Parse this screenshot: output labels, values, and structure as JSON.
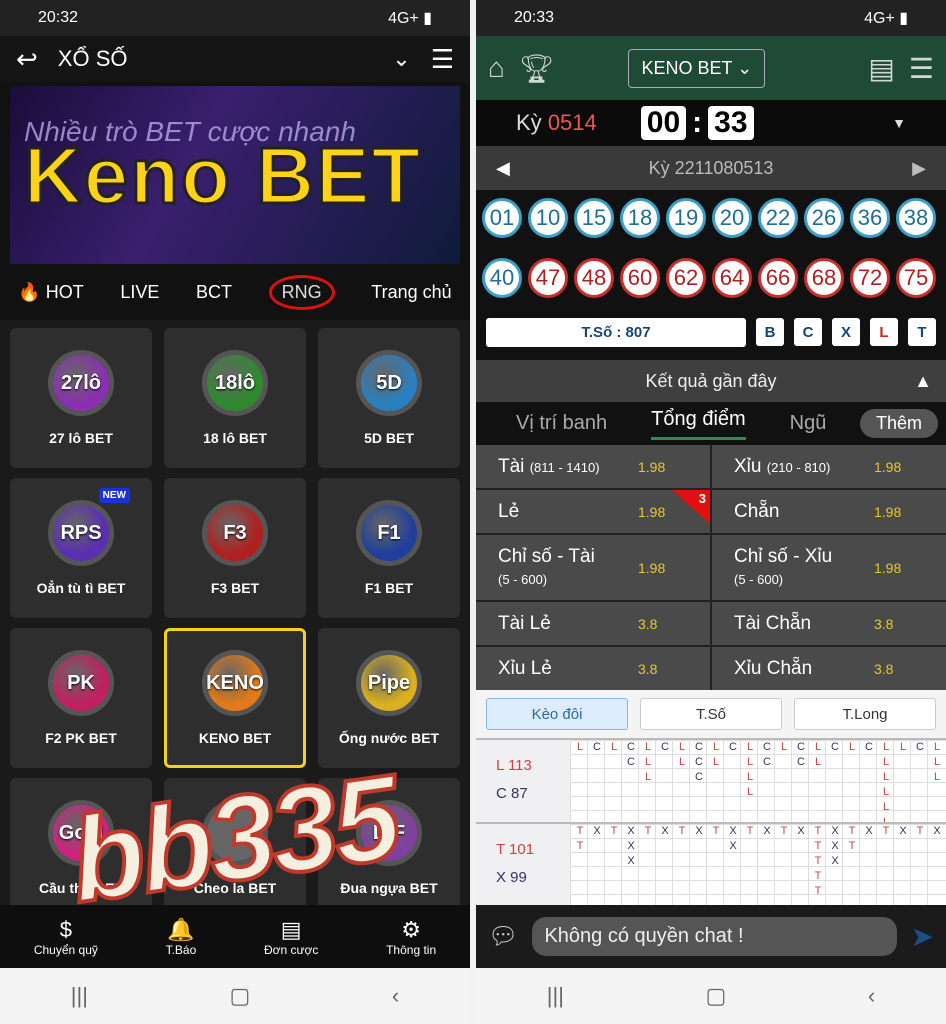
{
  "left": {
    "status_time": "20:32",
    "status_right": "4G+ ▮",
    "title": "XỔ SỐ",
    "banner_sub": "Nhiều trò BET cược nhanh",
    "banner_big": "Keno BET",
    "tabs": [
      "🔥 HOT",
      "LIVE",
      "BCT",
      "RNG",
      "Trang chủ"
    ],
    "games": [
      {
        "coin": "27lô",
        "label": "27 lô BET",
        "color": "#8a2fb0"
      },
      {
        "coin": "18lô",
        "label": "18 lô BET",
        "color": "#2f8a2f"
      },
      {
        "coin": "5D",
        "label": "5D BET",
        "color": "#2a7fc0"
      },
      {
        "coin": "RPS",
        "label": "Oẳn tù tì BET",
        "color": "#5a2fb0",
        "badge": "NEW"
      },
      {
        "coin": "F3",
        "label": "F3 BET",
        "color": "#b02020"
      },
      {
        "coin": "F1",
        "label": "F1 BET",
        "color": "#1f3f9a"
      },
      {
        "coin": "PK",
        "label": "F2 PK BET",
        "color": "#c02060"
      },
      {
        "coin": "KENO",
        "label": "KENO BET",
        "color": "#e07a1a",
        "selected": true
      },
      {
        "coin": "Pipe",
        "label": "Ống nước BET",
        "color": "#d8b020"
      },
      {
        "coin": "Goal",
        "label": "Cầu thủ BET",
        "color": "#d02080"
      },
      {
        "coin": "",
        "label": "Cheo la BET",
        "color": "#666"
      },
      {
        "coin": "D F",
        "label": "Đua ngựa BET",
        "color": "#8040a0"
      }
    ],
    "watermark": "bb335",
    "nav": [
      {
        "icon": "$",
        "label": "Chuyển quỹ"
      },
      {
        "icon": "🔔",
        "label": "T.Báo"
      },
      {
        "icon": "▤",
        "label": "Đơn cược"
      },
      {
        "icon": "⚙",
        "label": "Thông tin"
      }
    ]
  },
  "right": {
    "status_time": "20:33",
    "status_right": "4G+ ▮",
    "select": "KENO BET",
    "ky_label": "Kỳ",
    "ky_value": "0514",
    "clock_m": "00",
    "clock_s": "33",
    "prev_ky": "Kỳ 2211080513",
    "balls": [
      "01",
      "10",
      "15",
      "18",
      "19",
      "20",
      "22",
      "26",
      "36",
      "38",
      "40",
      "47",
      "48",
      "60",
      "62",
      "64",
      "66",
      "68",
      "72",
      "75"
    ],
    "ball_colors": [
      "b",
      "b",
      "b",
      "b",
      "b",
      "b",
      "b",
      "b",
      "b",
      "b",
      "b",
      "r",
      "r",
      "r",
      "r",
      "r",
      "r",
      "r",
      "r",
      "r"
    ],
    "tso": "T.Số : 807",
    "filters": [
      "B",
      "C",
      "X",
      "L",
      "T"
    ],
    "recent": "Kết quả gần đây",
    "tabs": [
      "Vị trí banh",
      "Tổng điểm",
      "Ngũ"
    ],
    "more": "Thêm",
    "odds": [
      {
        "label": "Tài",
        "range": "(811 - 1410)",
        "v": "1.98"
      },
      {
        "label": "Xỉu",
        "range": "(210 - 810)",
        "v": "1.98"
      },
      {
        "label": "Lẻ",
        "range": "",
        "v": "1.98",
        "flag": "3"
      },
      {
        "label": "Chẵn",
        "range": "",
        "v": "1.98"
      },
      {
        "label": "Chỉ số - Tài",
        "range": "(5 - 600)",
        "v": "1.98"
      },
      {
        "label": "Chỉ số - Xỉu",
        "range": "(5 - 600)",
        "v": "1.98"
      },
      {
        "label": "Tài Lẻ",
        "range": "",
        "v": "3.8"
      },
      {
        "label": "Tài Chẵn",
        "range": "",
        "v": "3.8"
      },
      {
        "label": "Xỉu Lẻ",
        "range": "",
        "v": "3.8"
      },
      {
        "label": "Xỉu Chẵn",
        "range": "",
        "v": "3.8"
      }
    ],
    "road_buttons": [
      "Kèo đôi",
      "T.Số",
      "T.Long"
    ],
    "road1": {
      "a": "L 113",
      "b": "C 87",
      "cols": [
        "L",
        "C",
        "L",
        "CC",
        "LLL",
        "C",
        "LL",
        "CCC",
        "LL",
        "C",
        "LLLL",
        "CC",
        "L",
        "CC",
        "LL",
        "C",
        "L",
        "C",
        "LLLLLL",
        "L",
        "C",
        "LLL"
      ]
    },
    "road2": {
      "a": "T 101",
      "b": "X 99",
      "cols": [
        "TT",
        "X",
        "T",
        "XXX",
        "T",
        "X",
        "T",
        "X",
        "T",
        "XX",
        "T",
        "X",
        "T",
        "X",
        "TTTTT",
        "XXX",
        "TT",
        "X",
        "T",
        "X",
        "T",
        "X"
      ]
    },
    "chat_placeholder": "Không có quyền chat !"
  }
}
